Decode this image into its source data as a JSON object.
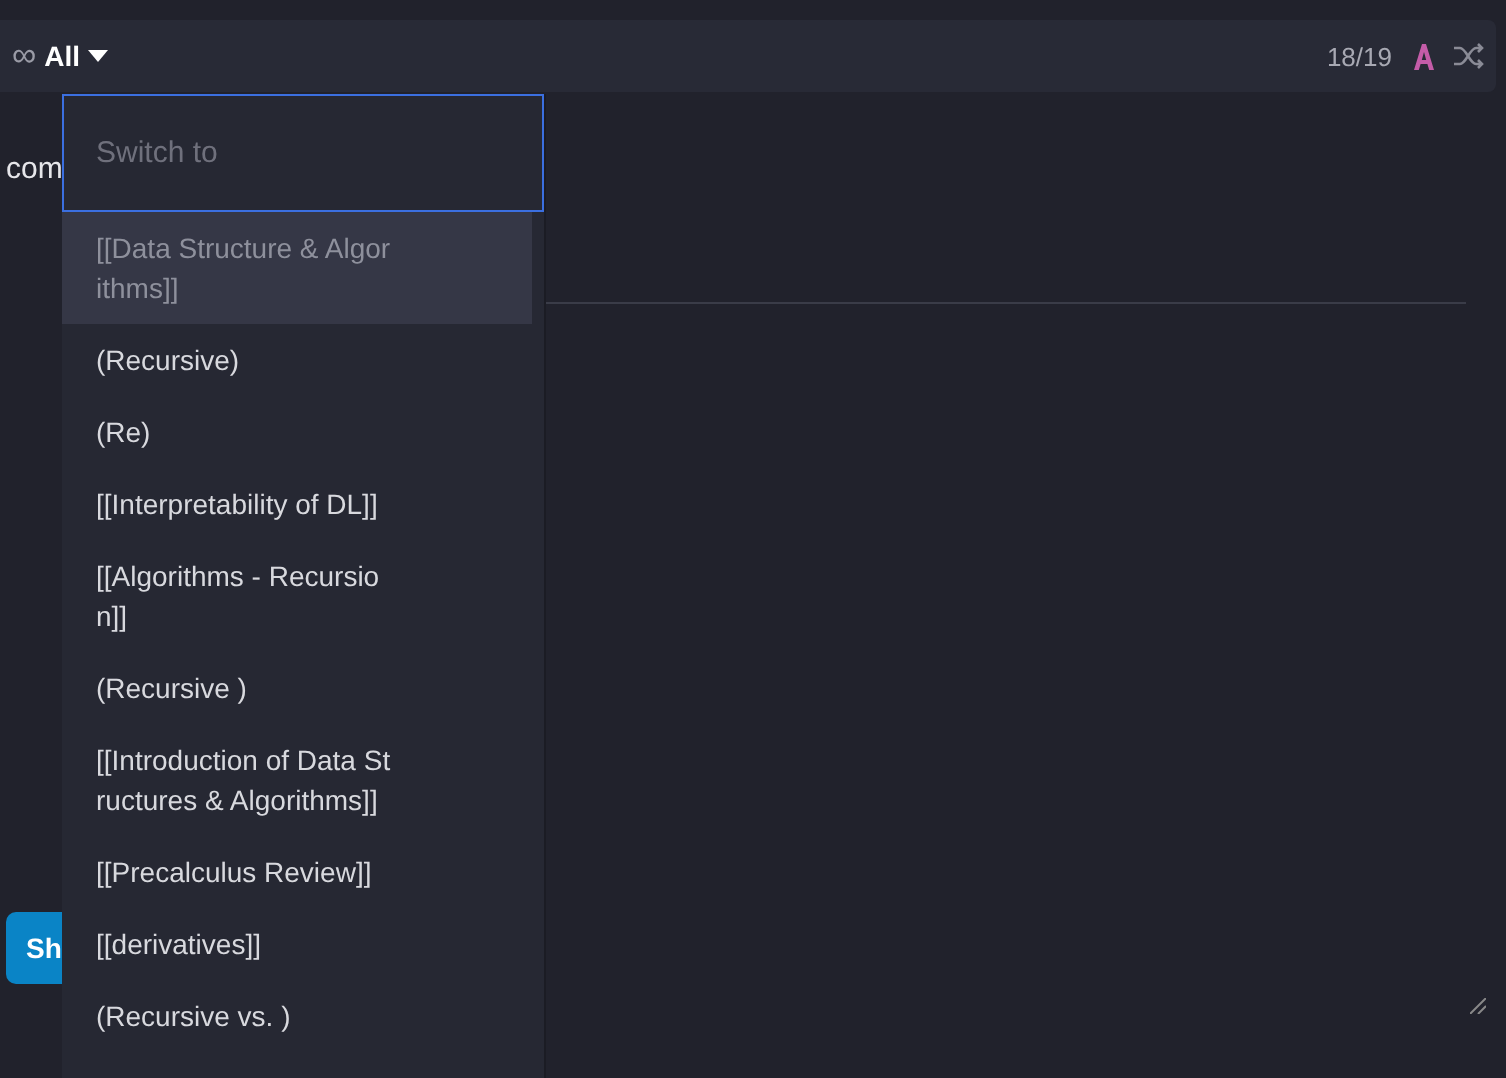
{
  "toolbar": {
    "loop_icon": "∞",
    "filter": "All",
    "counter": "18/19"
  },
  "background": {
    "text": "com",
    "button": "Sh"
  },
  "switcher": {
    "placeholder": "Switch to",
    "items": [
      {
        "label": "[[Data Structure & Algorithms]]",
        "selected": true
      },
      {
        "label": "(Recursive)",
        "selected": false
      },
      {
        "label": "(Re)",
        "selected": false
      },
      {
        "label": "[[Interpretability of DL]]",
        "selected": false
      },
      {
        "label": "[[Algorithms - Recursion]]",
        "selected": false
      },
      {
        "label": "(Recursive )",
        "selected": false
      },
      {
        "label": "[[Introduction of Data Structures & Algorithms]]",
        "selected": false
      },
      {
        "label": "[[Precalculus Review]]",
        "selected": false
      },
      {
        "label": "[[derivatives]]",
        "selected": false
      },
      {
        "label": "(Recursive vs. )",
        "selected": false
      }
    ]
  }
}
